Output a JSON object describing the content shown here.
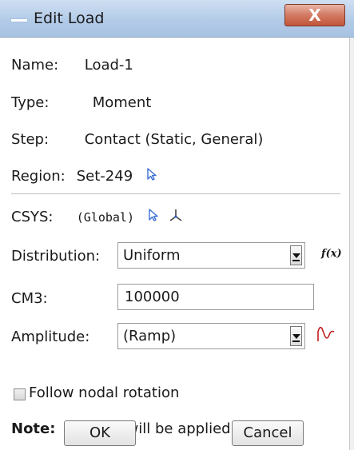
{
  "window": {
    "title": "Edit Load",
    "close_label": "X"
  },
  "fields": {
    "name": {
      "label": "Name:",
      "value": "Load-1"
    },
    "type": {
      "label": "Type:",
      "value": "Moment"
    },
    "step": {
      "label": "Step:",
      "value": "Contact (Static, General)"
    },
    "region": {
      "label": "Region:",
      "value": "Set-249"
    },
    "csys": {
      "label": "CSYS:",
      "value": "(Global)"
    },
    "distribution": {
      "label": "Distribution:",
      "value": "Uniform",
      "fx_label": "f(x)"
    },
    "cm3": {
      "label": "CM3:",
      "value": "100000"
    },
    "amplitude": {
      "label": "Amplitude:",
      "value": "(Ramp)"
    }
  },
  "options": {
    "follow_nodal_rotation": {
      "label": "Follow nodal rotation",
      "checked": false
    }
  },
  "note": {
    "prefix": "Note:",
    "text": "Moment will be applied per node."
  },
  "buttons": {
    "ok": "OK",
    "cancel": "Cancel"
  },
  "colors": {
    "title_bar": "#b3cbe8",
    "close_button": "#c2553a",
    "cursor_icon": "#3a6fd8",
    "amplitude_icon": "#c21f1f"
  },
  "icons": {
    "region_select": "cursor-arrow-icon",
    "csys_select": "cursor-arrow-icon",
    "csys_axes": "triad-axes-icon",
    "distribution_fx": "function-fx-icon",
    "amplitude_curve": "amplitude-curve-icon"
  }
}
